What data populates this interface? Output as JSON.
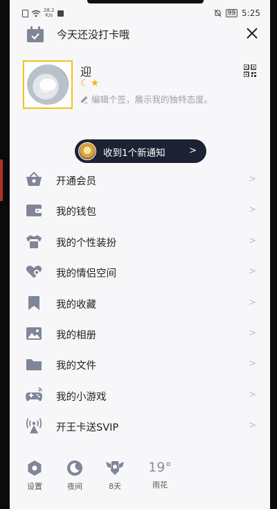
{
  "status_bar": {
    "net_speed_value": "28.2",
    "net_speed_unit": "K/s",
    "battery": "99",
    "time": "5:25"
  },
  "header": {
    "checkin_text": "今天还没打卡哦"
  },
  "profile": {
    "username": "迎",
    "signature": "编辑个签，展示我的独特态度。"
  },
  "notice": {
    "text": "收到1个新通知"
  },
  "menu": [
    {
      "label": "开通会员",
      "icon": "vip-basket-icon"
    },
    {
      "label": "我的钱包",
      "icon": "wallet-icon"
    },
    {
      "label": "我的个性装扮",
      "icon": "tshirt-icon"
    },
    {
      "label": "我的情侣空间",
      "icon": "couple-heart-icon"
    },
    {
      "label": "我的收藏",
      "icon": "bookmark-icon"
    },
    {
      "label": "我的相册",
      "icon": "photo-album-icon"
    },
    {
      "label": "我的文件",
      "icon": "folder-icon"
    },
    {
      "label": "我的小游戏",
      "icon": "gamepad-icon"
    },
    {
      "label": "开王卡送SVIP",
      "icon": "signal-tower-icon"
    }
  ],
  "bottom_bar": {
    "settings_label": "设置",
    "night_label": "夜间",
    "streak_label": "8天",
    "weather_temp": "19°",
    "weather_label": "雨花"
  },
  "colors": {
    "icon_gray": "#7f8697",
    "avatar_border": "#f2c21a",
    "notice_bg": "#1c2133",
    "background": "#f7f7f9"
  }
}
